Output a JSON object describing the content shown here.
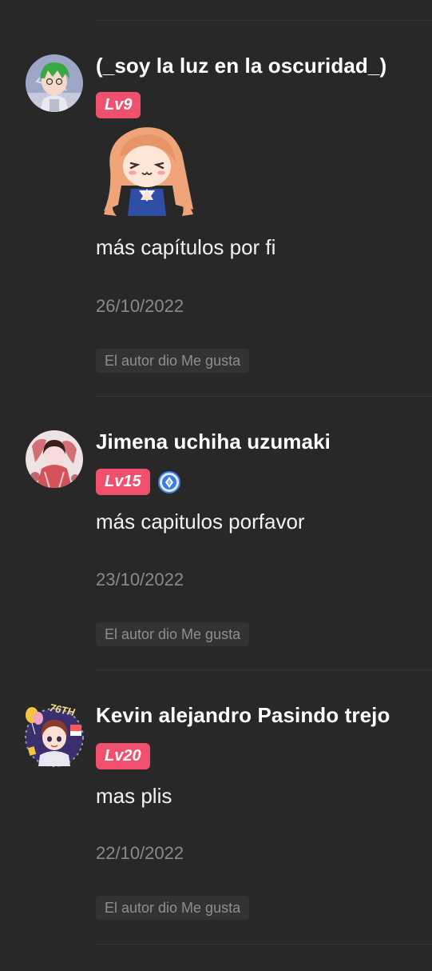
{
  "comments": [
    {
      "username": "(_soy la luz en la oscuridad_)",
      "level": "Lv9",
      "has_sticker": true,
      "has_vip_badge": false,
      "text": "más capítulos por fi",
      "date": "26/10/2022",
      "author_liked_label": "El autor dio Me gusta"
    },
    {
      "username": "Jimena uchiha uzumaki",
      "level": "Lv15",
      "has_sticker": false,
      "has_vip_badge": true,
      "text": "más capitulos porfavor",
      "date": "23/10/2022",
      "author_liked_label": "El autor dio Me gusta"
    },
    {
      "username": "Kevin alejandro Pasindo trejo",
      "level": "Lv20",
      "has_sticker": false,
      "has_vip_badge": false,
      "avatar_frame_text": "76TH",
      "text": "mas plis",
      "date": "22/10/2022",
      "author_liked_label": "El autor dio Me gusta"
    }
  ],
  "colors": {
    "background": "#282828",
    "level_badge": "#f0506e",
    "divider": "#363636",
    "date_text": "#8a8a8a",
    "liked_chip_bg": "#333333"
  }
}
